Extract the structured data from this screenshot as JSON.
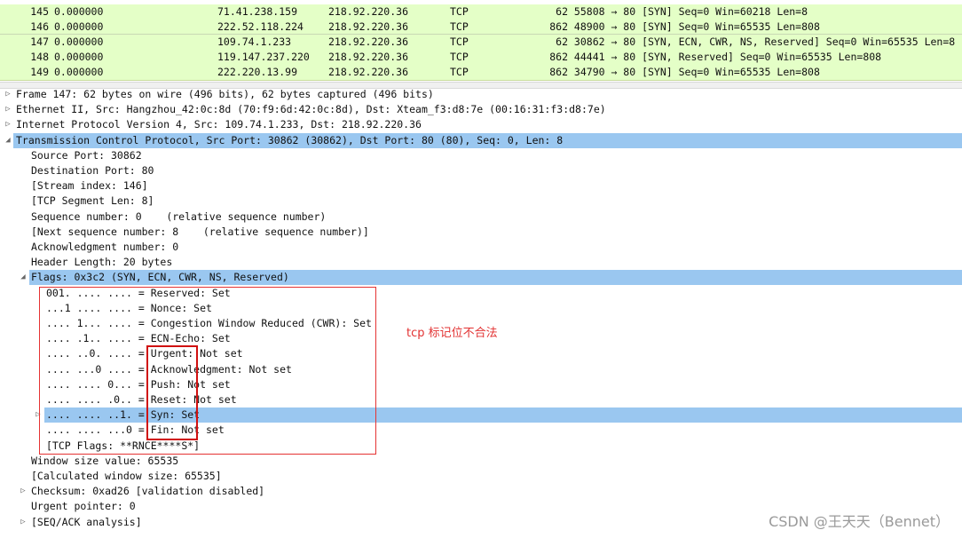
{
  "packet_list": {
    "rows": [
      {
        "no": "145",
        "time": "0.000000",
        "src": "71.41.238.159",
        "dst": "218.92.220.36",
        "proto": "TCP",
        "len": "62",
        "info": "55808 → 80 [SYN] Seq=0 Win=60218 Len=8",
        "selected": false
      },
      {
        "no": "146",
        "time": "0.000000",
        "src": "222.52.118.224",
        "dst": "218.92.220.36",
        "proto": "TCP",
        "len": "862",
        "info": "48900 → 80 [SYN] Seq=0 Win=65535 Len=808",
        "selected": false
      },
      {
        "no": "147",
        "time": "0.000000",
        "src": "109.74.1.233",
        "dst": "218.92.220.36",
        "proto": "TCP",
        "len": "62",
        "info": "30862 → 80 [SYN, ECN, CWR, NS, Reserved] Seq=0 Win=65535 Len=8",
        "selected": true
      },
      {
        "no": "148",
        "time": "0.000000",
        "src": "119.147.237.220",
        "dst": "218.92.220.36",
        "proto": "TCP",
        "len": "862",
        "info": "44441 → 80 [SYN, Reserved] Seq=0 Win=65535 Len=808",
        "selected": false
      },
      {
        "no": "149",
        "time": "0.000000",
        "src": "222.220.13.99",
        "dst": "218.92.220.36",
        "proto": "TCP",
        "len": "862",
        "info": "34790 → 80 [SYN] Seq=0 Win=65535 Len=808",
        "selected": false
      }
    ]
  },
  "details": [
    {
      "level": 0,
      "expander": "▷",
      "text": "Frame 147: 62 bytes on wire (496 bits), 62 bytes captured (496 bits)",
      "highlight": false
    },
    {
      "level": 0,
      "expander": "▷",
      "text": "Ethernet II, Src: Hangzhou_42:0c:8d (70:f9:6d:42:0c:8d), Dst: Xteam_f3:d8:7e (00:16:31:f3:d8:7e)",
      "highlight": false
    },
    {
      "level": 0,
      "expander": "▷",
      "text": "Internet Protocol Version 4, Src: 109.74.1.233, Dst: 218.92.220.36",
      "highlight": false
    },
    {
      "level": 0,
      "expander": "◢",
      "text": "Transmission Control Protocol, Src Port: 30862 (30862), Dst Port: 80 (80), Seq: 0, Len: 8",
      "highlight": true
    },
    {
      "level": 1,
      "expander": "",
      "text": "Source Port: 30862",
      "highlight": false
    },
    {
      "level": 1,
      "expander": "",
      "text": "Destination Port: 80",
      "highlight": false
    },
    {
      "level": 1,
      "expander": "",
      "text": "[Stream index: 146]",
      "highlight": false
    },
    {
      "level": 1,
      "expander": "",
      "text": "[TCP Segment Len: 8]",
      "highlight": false
    },
    {
      "level": 1,
      "expander": "",
      "text": "Sequence number: 0    (relative sequence number)",
      "highlight": false
    },
    {
      "level": 1,
      "expander": "",
      "text": "[Next sequence number: 8    (relative sequence number)]",
      "highlight": false
    },
    {
      "level": 1,
      "expander": "",
      "text": "Acknowledgment number: 0",
      "highlight": false
    },
    {
      "level": 1,
      "expander": "",
      "text": "Header Length: 20 bytes",
      "highlight": false
    },
    {
      "level": 1,
      "expander": "◢",
      "text": "Flags: 0x3c2 (SYN, ECN, CWR, NS, Reserved)",
      "highlight": true
    },
    {
      "level": 2,
      "expander": "",
      "text": "001. .... .... = Reserved: Set",
      "highlight": false
    },
    {
      "level": 2,
      "expander": "",
      "text": "...1 .... .... = Nonce: Set",
      "highlight": false
    },
    {
      "level": 2,
      "expander": "",
      "text": ".... 1... .... = Congestion Window Reduced (CWR): Set",
      "highlight": false
    },
    {
      "level": 2,
      "expander": "",
      "text": ".... .1.. .... = ECN-Echo: Set",
      "highlight": false
    },
    {
      "level": 2,
      "expander": "",
      "text": ".... ..0. .... = Urgent: Not set",
      "highlight": false
    },
    {
      "level": 2,
      "expander": "",
      "text": ".... ...0 .... = Acknowledgment: Not set",
      "highlight": false
    },
    {
      "level": 2,
      "expander": "",
      "text": ".... .... 0... = Push: Not set",
      "highlight": false
    },
    {
      "level": 2,
      "expander": "",
      "text": ".... .... .0.. = Reset: Not set",
      "highlight": false
    },
    {
      "level": 2,
      "expander": "▷",
      "text": ".... .... ..1. = Syn: Set",
      "highlight": true
    },
    {
      "level": 2,
      "expander": "",
      "text": ".... .... ...0 = Fin: Not set",
      "highlight": false
    },
    {
      "level": 2,
      "expander": "",
      "text": "[TCP Flags: **RNCE****S*]",
      "highlight": false
    },
    {
      "level": 1,
      "expander": "",
      "text": "Window size value: 65535",
      "highlight": false
    },
    {
      "level": 1,
      "expander": "",
      "text": "[Calculated window size: 65535]",
      "highlight": false
    },
    {
      "level": 1,
      "expander": "▷",
      "text": "Checksum: 0xad26 [validation disabled]",
      "highlight": false
    },
    {
      "level": 1,
      "expander": "",
      "text": "Urgent pointer: 0",
      "highlight": false
    },
    {
      "level": 1,
      "expander": "▷",
      "text": "[SEQ/ACK analysis]",
      "highlight": false
    }
  ],
  "annotation": {
    "note": "tcp 标记位不合法"
  },
  "watermark": "CSDN @王天天（Bennet）",
  "colors": {
    "packet_row": "#e4ffc7",
    "highlight_row": "#9ac7f0",
    "annotation_red": "#e53333"
  }
}
